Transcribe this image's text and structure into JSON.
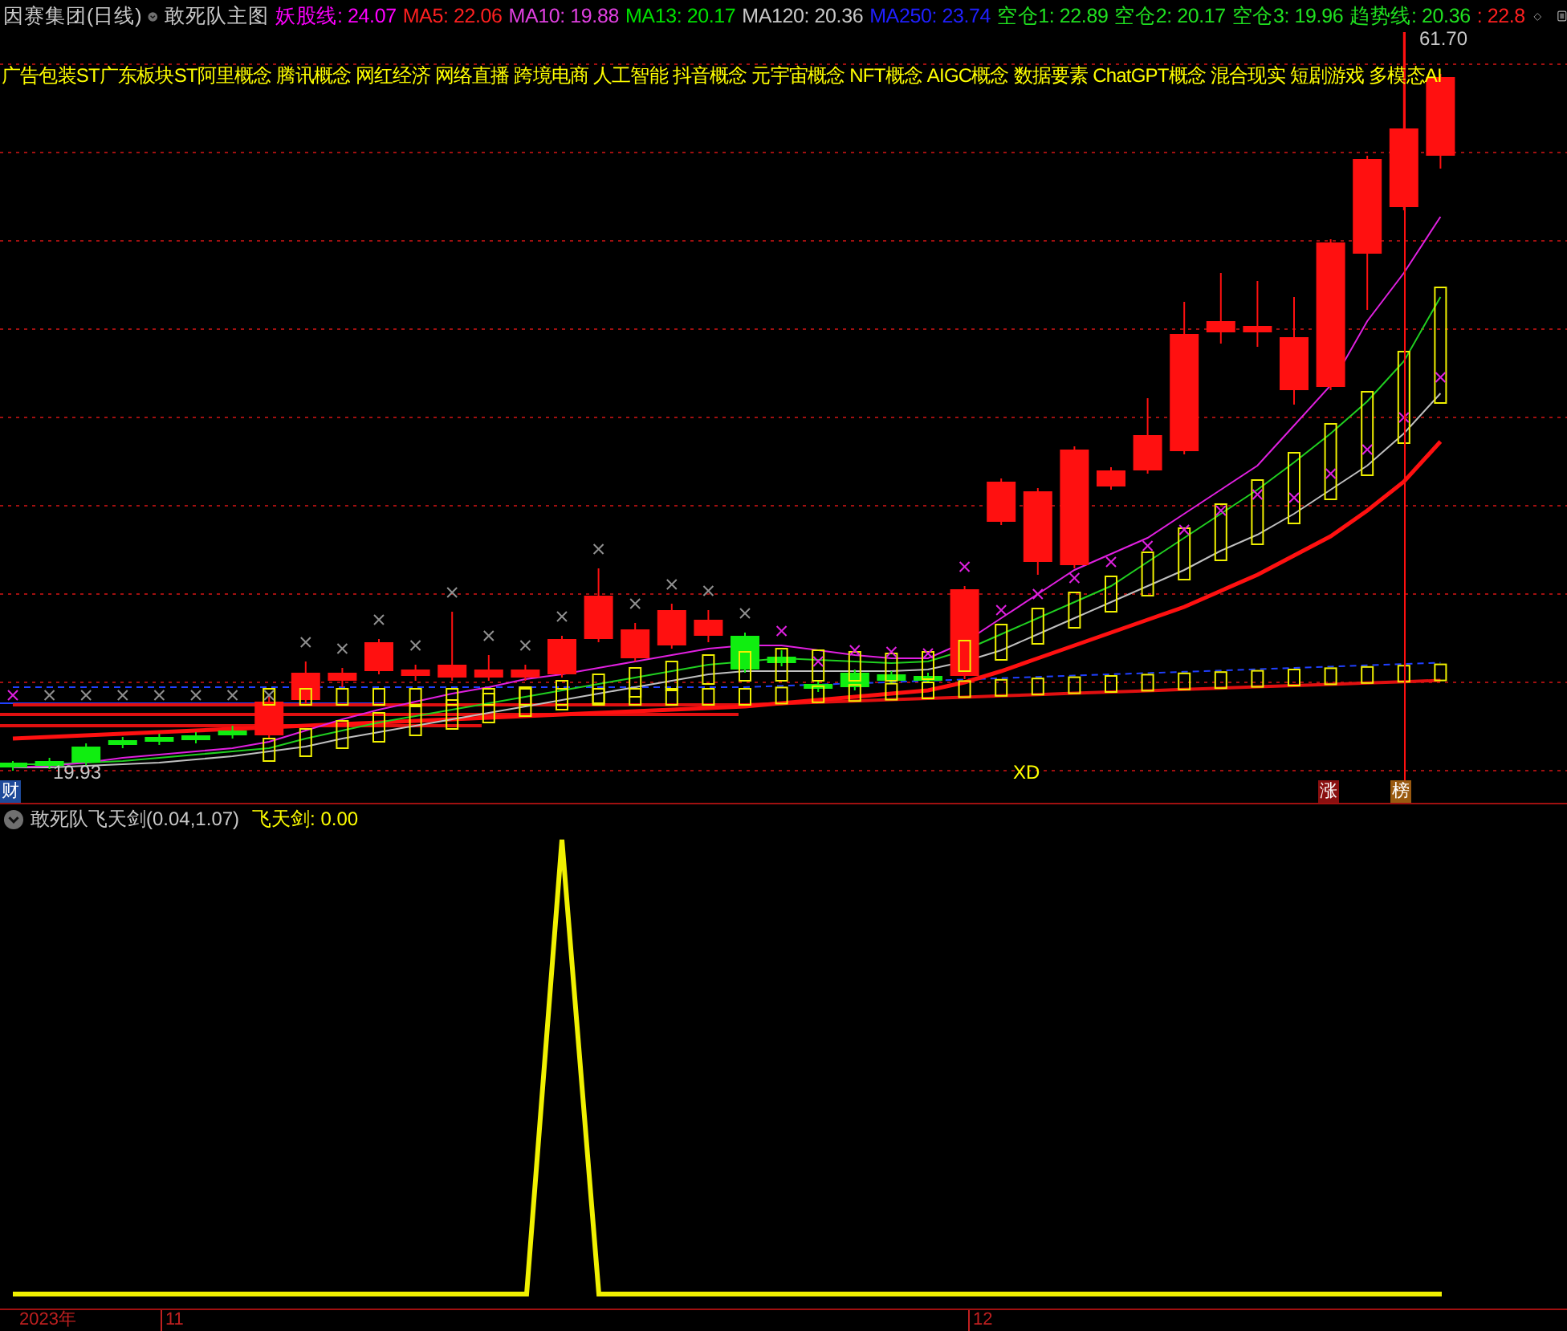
{
  "header": {
    "title": "因赛集团(日线)",
    "indicator": "敢死队主图",
    "legend": [
      {
        "label": "妖股线:",
        "value": "24.07",
        "color": "#ff00ff"
      },
      {
        "label": "MA5:",
        "value": "22.06",
        "color": "#ff2020"
      },
      {
        "label": "MA10:",
        "value": "19.88",
        "color": "#e040e0"
      },
      {
        "label": "MA13:",
        "value": "20.17",
        "color": "#00e000"
      },
      {
        "label": "MA120:",
        "value": "20.36",
        "color": "#c8c8c8"
      },
      {
        "label": "MA250:",
        "value": "23.74",
        "color": "#2020ff"
      },
      {
        "label": "空仓1:",
        "value": "22.89",
        "color": "#20e020"
      },
      {
        "label": "空仓2:",
        "value": "20.17",
        "color": "#20e020"
      },
      {
        "label": "空仓3:",
        "value": "19.96",
        "color": "#20e020"
      },
      {
        "label": "趋势线:",
        "value": "20.36",
        "color": "#20e020"
      },
      {
        "label": ":",
        "value": "22.8",
        "color": "#ff2020"
      }
    ]
  },
  "main_chart": {
    "concepts": "广告包装ST广东板块ST阿里概念 腾讯概念 网红经济 网络直播 跨境电商 人工智能 抖音概念 元宇宙概念 NFT概念 AIGC概念 数据要素 ChatGPT概念 混合现实 短剧游戏 多模态AI",
    "high_label": "61.70",
    "low_label": "19.93",
    "event_label": "XD",
    "badges": [
      {
        "text": "财",
        "color": "#1e4a9a"
      },
      {
        "text": "涨",
        "color": "#8a1010"
      },
      {
        "text": "榜",
        "color": "#9a5a10"
      }
    ]
  },
  "sub_chart": {
    "name": "敢死队飞天剑(0.04,1.07)",
    "reading": "飞天剑: 0.00"
  },
  "time_axis": [
    "2023年",
    "11",
    "12"
  ]
}
